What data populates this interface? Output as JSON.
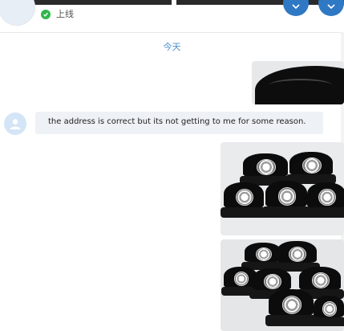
{
  "header": {
    "status_text": "上线",
    "status_color": "#2fb64a",
    "buttons": [
      "circle-button",
      "circle-button"
    ],
    "accent_color": "#2f78c4"
  },
  "conversation": {
    "date_divider": "今天",
    "messages": [
      {
        "type": "image",
        "direction": "outgoing",
        "content": "black snapback cap photo"
      },
      {
        "type": "text",
        "direction": "incoming",
        "text": "the address is correct but its not getting to me for some reason."
      },
      {
        "type": "image",
        "direction": "outgoing",
        "content": "group of black snapback caps with round patches"
      },
      {
        "type": "image",
        "direction": "outgoing",
        "content": "rows of black snapback caps with round patches"
      }
    ]
  }
}
